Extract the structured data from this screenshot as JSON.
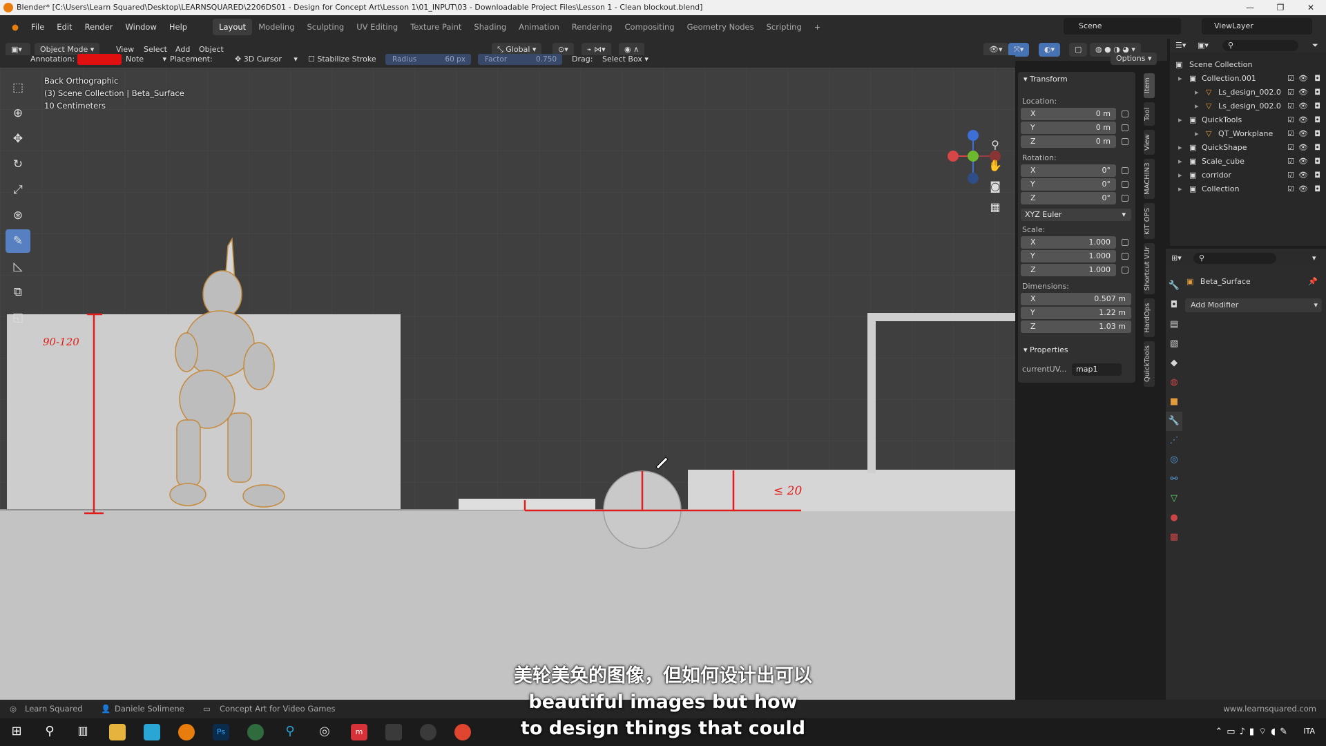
{
  "window": {
    "title": "Blender* [C:\\Users\\Learn Squared\\Desktop\\LEARNSQUARED\\2206DS01 - Design for Concept Art\\Lesson 1\\01_INPUT\\03 - Downloadable Project Files\\Lesson 1 - Clean blockout.blend]",
    "controls": [
      "—",
      "❐",
      "✕"
    ]
  },
  "menu": [
    "File",
    "Edit",
    "Render",
    "Window",
    "Help"
  ],
  "workspaces": [
    "Layout",
    "Modeling",
    "Sculpting",
    "UV Editing",
    "Texture Paint",
    "Shading",
    "Animation",
    "Rendering",
    "Compositing",
    "Geometry Nodes",
    "Scripting",
    "+"
  ],
  "active_workspace": "Layout",
  "scene_name": "Scene",
  "view_layer": "ViewLayer",
  "header": {
    "mode": "Object Mode",
    "view": "View",
    "select": "Select",
    "add": "Add",
    "object": "Object",
    "orientation": "Global"
  },
  "toolsettings": {
    "annotation_label": "Annotation:",
    "annotation_color": "#e01010",
    "note": "Note",
    "placement_label": "Placement:",
    "placement_value": "3D Cursor",
    "stabilize": "Stabilize Stroke",
    "radius_label": "Radius",
    "radius_value": "60 px",
    "factor_label": "Factor",
    "factor_value": "0.750",
    "drag_label": "Drag:",
    "drag_value": "Select Box",
    "options": "Options"
  },
  "viewport": {
    "view_name": "Back Orthographic",
    "collection_info": "(3) Scene Collection | Beta_Surface",
    "scale": "10 Centimeters",
    "annotations": [
      "90-120",
      "≤ 20"
    ]
  },
  "transform": {
    "title": "Transform",
    "location_label": "Location:",
    "location": [
      {
        "axis": "X",
        "value": "0 m"
      },
      {
        "axis": "Y",
        "value": "0 m"
      },
      {
        "axis": "Z",
        "value": "0 m"
      }
    ],
    "rotation_label": "Rotation:",
    "rotation": [
      {
        "axis": "X",
        "value": "0°"
      },
      {
        "axis": "Y",
        "value": "0°"
      },
      {
        "axis": "Z",
        "value": "0°"
      }
    ],
    "rotation_mode": "XYZ Euler",
    "scale_label": "Scale:",
    "scale": [
      {
        "axis": "X",
        "value": "1.000"
      },
      {
        "axis": "Y",
        "value": "1.000"
      },
      {
        "axis": "Z",
        "value": "1.000"
      }
    ],
    "dimensions_label": "Dimensions:",
    "dimensions": [
      {
        "axis": "X",
        "value": "0.507 m"
      },
      {
        "axis": "Y",
        "value": "1.22 m"
      },
      {
        "axis": "Z",
        "value": "1.03 m"
      }
    ]
  },
  "properties_panel": {
    "title": "Properties",
    "current_uv_label": "currentUV...",
    "current_uv_value": "map1"
  },
  "side_tabs": [
    "Item",
    "Tool",
    "View",
    "MACHIN3",
    "KIT OPS",
    "Shortcut VUr",
    "HardOps",
    "QuickTools"
  ],
  "outliner": {
    "root": "Scene Collection",
    "rows": [
      {
        "name": "Collection.001",
        "level": 1
      },
      {
        "name": "Ls_design_002.0",
        "level": 2
      },
      {
        "name": "Ls_design_002.0",
        "level": 2
      },
      {
        "name": "QuickTools",
        "level": 1
      },
      {
        "name": "QT_Workplane",
        "level": 2
      },
      {
        "name": "QuickShape",
        "level": 1
      },
      {
        "name": "Scale_cube",
        "level": 1
      },
      {
        "name": "corridor",
        "level": 1
      },
      {
        "name": "Collection",
        "level": 1
      }
    ]
  },
  "modifier_panel": {
    "object_name": "Beta_Surface",
    "add_modifier": "Add Modifier"
  },
  "statusbar": {
    "left": "Learn Squared",
    "author": "Daniele Solimene",
    "course": "Concept Art for Video Games",
    "url": "www.learnsquared.com"
  },
  "subtitles": {
    "zh": "美轮美奂的图像，但如何设计出可以",
    "en1": "beautiful images but how",
    "en2": "to design things that could"
  },
  "taskbar": {
    "lang": "ITA"
  }
}
